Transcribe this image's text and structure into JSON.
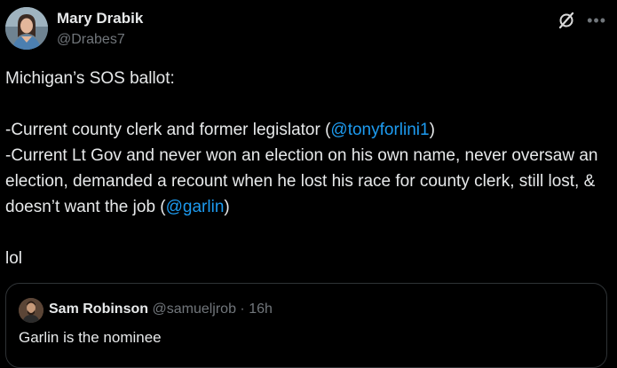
{
  "author": {
    "display_name": "Mary Drabik",
    "handle": "@Drabes7"
  },
  "icons": {
    "grok": "grok-slash-circle-icon",
    "more": "more-horizontal-icon"
  },
  "tweet": {
    "line1": "Michigan’s SOS ballot:",
    "para2_prefix": "-Current county clerk and former legislator (",
    "mention1": "@tonyforlini1",
    "para2_suffix": ")",
    "para3_prefix": "-Current Lt Gov and never won an election on his own name, never oversaw an election, demanded a recount when he lost his race for county clerk, still lost, & doesn’t want the job (",
    "mention2": "@garlin",
    "para3_suffix": ")",
    "line_last": "lol"
  },
  "quote": {
    "display_name": "Sam Robinson",
    "handle": "@samueljrob",
    "separator": "·",
    "time": "16h",
    "text": "Garlin is the nominee"
  },
  "colors": {
    "background": "#000000",
    "text": "#e7e9ea",
    "secondary": "#71767b",
    "link": "#1d9bf0",
    "border": "#2f3336"
  }
}
